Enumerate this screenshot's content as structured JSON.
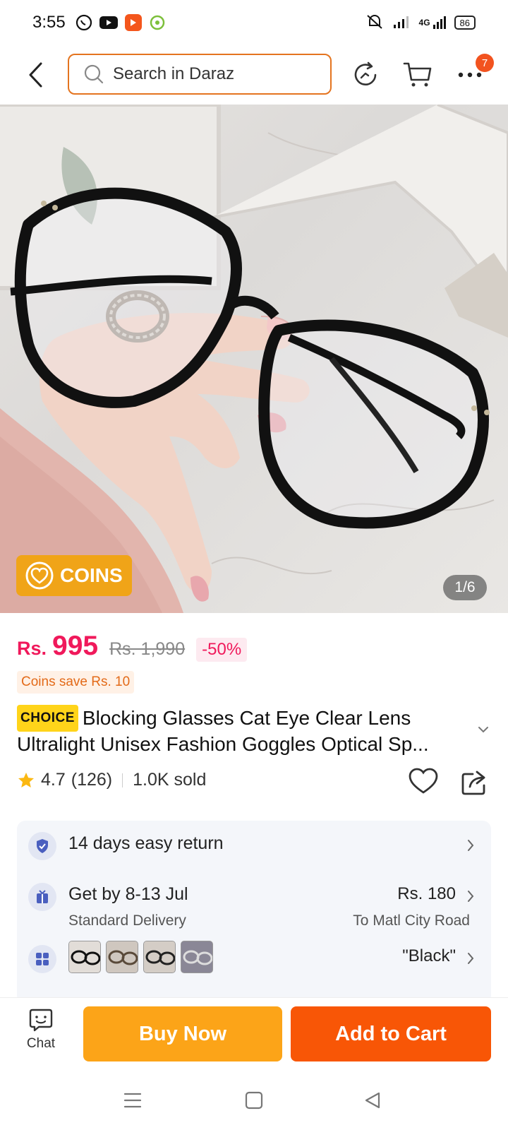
{
  "status_bar": {
    "time": "3:55",
    "battery": "86",
    "network": "4G"
  },
  "header": {
    "search_placeholder": "Search in Daraz",
    "more_badge": "7"
  },
  "gallery": {
    "coins_label": "COINS",
    "counter": "1/6"
  },
  "price": {
    "currency": "Rs.",
    "current": "995",
    "original": "Rs. 1,990",
    "discount": "-50%",
    "coins_save": "Coins save Rs. 10"
  },
  "product": {
    "choice_tag": "CHOICE",
    "title_line1": "Blocking Glasses Cat Eye Clear Lens",
    "title_line2": "Ultralight Unisex Fashion Goggles Optical Sp...",
    "rating": "4.7",
    "reviews": "(126)",
    "sold": "1.0K sold"
  },
  "info": {
    "return_text": "14 days easy return",
    "delivery_title": "Get by 8-13 Jul",
    "delivery_sub": "Standard Delivery",
    "delivery_price": "Rs. 180",
    "delivery_to": "To Matl City Road",
    "variant_selected": "\"Black\""
  },
  "bottom": {
    "chat_label": "Chat",
    "buy_now": "Buy Now",
    "add_to_cart": "Add to Cart"
  },
  "colors": {
    "accent": "#f85606",
    "buy_now": "#fca418",
    "price": "#f0195b",
    "search_border": "#e4741f"
  }
}
